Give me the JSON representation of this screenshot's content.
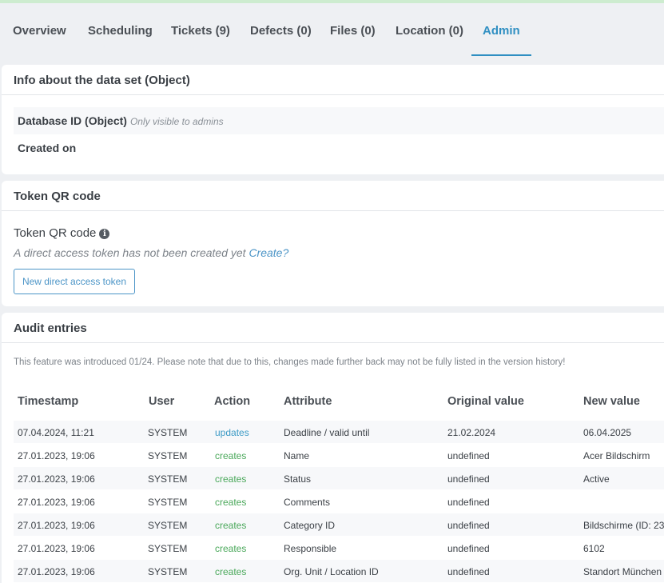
{
  "tabs": [
    {
      "label": "Overview"
    },
    {
      "label": "Scheduling"
    },
    {
      "label": "Tickets (9)"
    },
    {
      "label": "Defects (0)"
    },
    {
      "label": "Files (0)"
    },
    {
      "label": "Location (0)"
    },
    {
      "label": "Admin"
    }
  ],
  "info_card": {
    "title": "Info about the data set (Object)",
    "db_id_label": "Database ID (Object)",
    "db_id_note": "Only visible to admins",
    "created_label": "Created on"
  },
  "qr_card": {
    "title": "Token QR code",
    "label": "Token QR code",
    "info_glyph": "i",
    "note": "A direct access token has not been created yet",
    "create_link": "Create?",
    "button_label": "New direct access token"
  },
  "audit": {
    "title": "Audit entries",
    "note": "This feature was introduced 01/24. Please note that due to this, changes made further back may not be fully listed in the version history!",
    "columns": [
      "Timestamp",
      "User",
      "Action",
      "Attribute",
      "Original value",
      "New value"
    ],
    "rows": [
      {
        "timestamp": "07.04.2024, 11:21",
        "user": "SYSTEM",
        "action": "updates",
        "attribute": "Deadline / valid until",
        "original": "21.02.2024",
        "new": "06.04.2025"
      },
      {
        "timestamp": "27.01.2023, 19:06",
        "user": "SYSTEM",
        "action": "creates",
        "attribute": "Name",
        "original": "undefined",
        "new": "Acer Bildschirm"
      },
      {
        "timestamp": "27.01.2023, 19:06",
        "user": "SYSTEM",
        "action": "creates",
        "attribute": "Status",
        "original": "undefined",
        "new": "Active"
      },
      {
        "timestamp": "27.01.2023, 19:06",
        "user": "SYSTEM",
        "action": "creates",
        "attribute": "Comments",
        "original": "undefined",
        "new": ""
      },
      {
        "timestamp": "27.01.2023, 19:06",
        "user": "SYSTEM",
        "action": "creates",
        "attribute": "Category ID",
        "original": "undefined",
        "new": "Bildschirme (ID: 23"
      },
      {
        "timestamp": "27.01.2023, 19:06",
        "user": "SYSTEM",
        "action": "creates",
        "attribute": "Responsible",
        "original": "undefined",
        "new": "6102"
      },
      {
        "timestamp": "27.01.2023, 19:06",
        "user": "SYSTEM",
        "action": "creates",
        "attribute": "Org. Unit / Location ID",
        "original": "undefined",
        "new": "Standort München"
      }
    ]
  },
  "colors": {
    "accent": "#2f8fc2",
    "updates": "#3d9bc6",
    "creates": "#4aa85a",
    "top_bar": "#cdeccf"
  }
}
